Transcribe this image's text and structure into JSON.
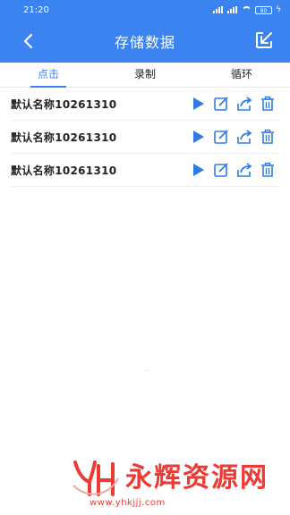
{
  "status_bar": {
    "time": "21:20",
    "battery": "80"
  },
  "header": {
    "title": "存储数据"
  },
  "tabs": [
    {
      "label": "点击",
      "active": true
    },
    {
      "label": "录制",
      "active": false
    },
    {
      "label": "循环",
      "active": false
    }
  ],
  "records": [
    {
      "name": "默认名称10261310"
    },
    {
      "name": "默认名称10261310"
    },
    {
      "name": "默认名称10261310"
    }
  ],
  "icons": {
    "back": "chevron-left-icon",
    "export": "export-box-icon",
    "play": "play-icon",
    "edit": "edit-icon",
    "share": "share-icon",
    "delete": "trash-icon"
  },
  "watermark": {
    "text": "永辉资源网",
    "url": "www.yhkjjj.com"
  },
  "colors": {
    "primary": "#3a83f1",
    "watermark": "#ee3a34"
  }
}
